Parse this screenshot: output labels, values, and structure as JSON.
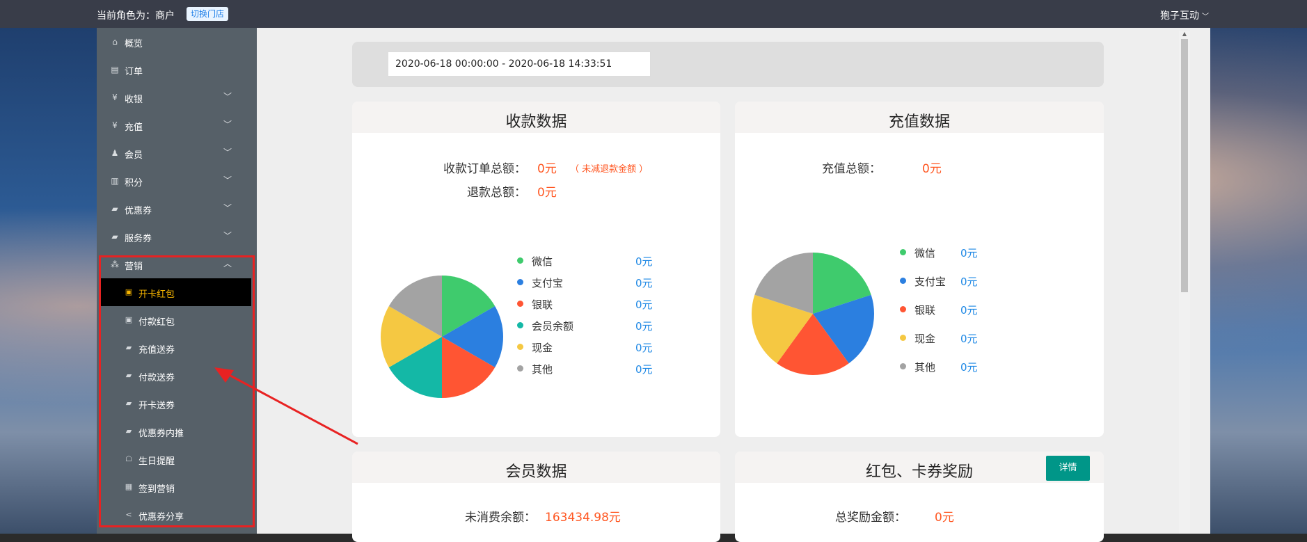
{
  "topbar": {
    "role_text": "当前角色为：商户",
    "switch_label": "切换门店",
    "user_name": "狍子互动",
    "user_chevron": "﹀"
  },
  "sidebar": {
    "items": [
      {
        "label": "概览",
        "icon": "home-icon",
        "glyph": "⌂",
        "has_arrow": false
      },
      {
        "label": "订单",
        "icon": "order-icon",
        "glyph": "▤",
        "has_arrow": false
      },
      {
        "label": "收银",
        "icon": "yen-icon",
        "glyph": "¥",
        "has_arrow": true
      },
      {
        "label": "充值",
        "icon": "yen-circle-icon",
        "glyph": "¥",
        "has_arrow": true
      },
      {
        "label": "会员",
        "icon": "member-icon",
        "glyph": "♟",
        "has_arrow": true
      },
      {
        "label": "积分",
        "icon": "points-icon",
        "glyph": "▥",
        "has_arrow": true
      },
      {
        "label": "优惠券",
        "icon": "coupon-icon",
        "glyph": "▰",
        "has_arrow": true
      },
      {
        "label": "服务券",
        "icon": "service-coupon-icon",
        "glyph": "▰",
        "has_arrow": true
      },
      {
        "label": "营销",
        "icon": "marketing-icon",
        "glyph": "⁂",
        "has_arrow": true,
        "expanded": true
      }
    ],
    "arrow_down": "﹀",
    "arrow_up": "︿",
    "sub_items": [
      {
        "label": "开卡红包",
        "icon": "red-packet-icon",
        "glyph": "▣",
        "active": true
      },
      {
        "label": "付款红包",
        "icon": "red-packet-icon",
        "glyph": "▣",
        "active": false
      },
      {
        "label": "充值送券",
        "icon": "coupon-icon",
        "glyph": "▰",
        "active": false
      },
      {
        "label": "付款送券",
        "icon": "coupon-icon",
        "glyph": "▰",
        "active": false
      },
      {
        "label": "开卡送券",
        "icon": "coupon-icon",
        "glyph": "▰",
        "active": false
      },
      {
        "label": "优惠券内推",
        "icon": "coupon-icon",
        "glyph": "▰",
        "active": false
      },
      {
        "label": "生日提醒",
        "icon": "cake-icon",
        "glyph": "☖",
        "active": false
      },
      {
        "label": "签到营销",
        "icon": "calendar-icon",
        "glyph": "▦",
        "active": false
      },
      {
        "label": "优惠券分享",
        "icon": "share-icon",
        "glyph": "<",
        "active": false
      }
    ]
  },
  "date_range": "2020-06-18 00:00:00 - 2020-06-18 14:33:51",
  "colors": {
    "wechat": "#3fcb6d",
    "alipay": "#2b7fe0",
    "unionpay": "#ff5533",
    "member_balance": "#14b8a6",
    "cash": "#f5c842",
    "other": "#a3a3a3",
    "value_red": "#ff5722",
    "value_blue": "#1e88e5"
  },
  "payment_card": {
    "title": "收款数据",
    "total_label": "收款订单总额：",
    "total_value": "0元",
    "total_note": "（ 未减退款金额 ）",
    "refund_label": "退款总额：",
    "refund_value": "0元",
    "legend": [
      {
        "name": "微信",
        "value": "0元",
        "color_key": "wechat"
      },
      {
        "name": "支付宝",
        "value": "0元",
        "color_key": "alipay"
      },
      {
        "name": "银联",
        "value": "0元",
        "color_key": "unionpay"
      },
      {
        "name": "会员余额",
        "value": "0元",
        "color_key": "member_balance"
      },
      {
        "name": "现金",
        "value": "0元",
        "color_key": "cash"
      },
      {
        "name": "其他",
        "value": "0元",
        "color_key": "other"
      }
    ]
  },
  "recharge_card": {
    "title": "充值数据",
    "total_label": "充值总额：",
    "total_value": "0元",
    "legend": [
      {
        "name": "微信",
        "value": "0元",
        "color_key": "wechat"
      },
      {
        "name": "支付宝",
        "value": "0元",
        "color_key": "alipay"
      },
      {
        "name": "银联",
        "value": "0元",
        "color_key": "unionpay"
      },
      {
        "name": "现金",
        "value": "0元",
        "color_key": "cash"
      },
      {
        "name": "其他",
        "value": "0元",
        "color_key": "other"
      }
    ]
  },
  "member_card": {
    "title": "会员数据",
    "balance_label": "未消费余额：",
    "balance_value": "163434.98元"
  },
  "reward_card": {
    "title": "红包、卡券奖励",
    "detail_label": "详情",
    "total_label": "总奖励金额：",
    "total_value": "0元"
  }
}
